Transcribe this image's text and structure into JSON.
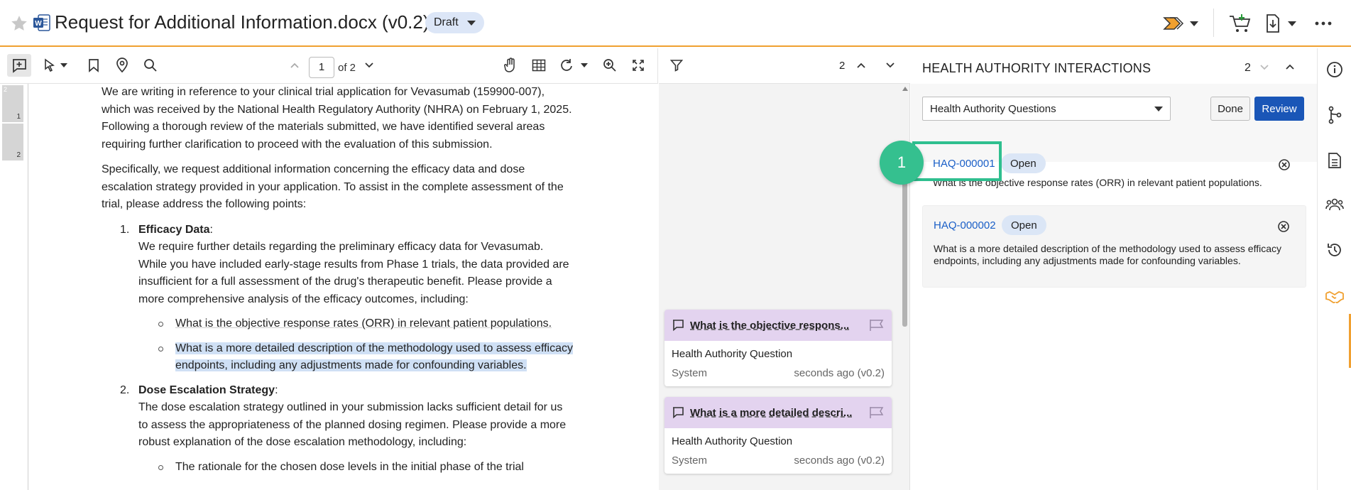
{
  "header": {
    "title": "Request for Additional Information.docx (v0.2)",
    "status": "Draft"
  },
  "doc_toolbar": {
    "page_current": "1",
    "page_of": "of 2"
  },
  "thumbnails": [
    {
      "top_label": "2",
      "label": "1"
    },
    {
      "top_label": "",
      "label": "2"
    }
  ],
  "document": {
    "p1": "We are writing in reference to your clinical trial application for Vevasumab (159900-007), which was received by the National Health Regulatory Authority (NHRA) on February 1, 2025. Following a thorough review of the materials submitted, we have identified several areas requiring further clarification to proceed with the evaluation of this submission.",
    "p2": "Specifically, we request additional information concerning the efficacy data and dose escalation strategy provided in your application. To assist in the complete assessment of the trial, please address the following points:",
    "item1_num": "1.",
    "item1_title": "Efficacy Data",
    "item1_body": "We require further details regarding the preliminary efficacy data for Vevasumab. While you have included early-stage results from Phase 1 trials, the data provided are insufficient for a full assessment of the drug's therapeutic benefit. Please provide a more comprehensive analysis of the efficacy outcomes, including:",
    "sub1": "What is the objective response rates (ORR) in relevant patient populations.",
    "sub2": "What is a more detailed description of the methodology used to assess efficacy endpoints, including any adjustments made for confounding variables.",
    "item2_num": "2.",
    "item2_title": "Dose Escalation Strategy",
    "item2_body": "The dose escalation strategy outlined in your submission lacks sufficient detail for us to assess the appropriateness of the planned dosing regimen. Please provide a more robust explanation of the dose escalation methodology, including:",
    "sub3": "The rationale for the chosen dose levels in the initial phase of the trial"
  },
  "comments_toolbar": {
    "count": "2"
  },
  "comment_cards": [
    {
      "title": "What is the objective respons...",
      "type": "Health Authority Question",
      "author": "System",
      "time": "seconds ago (v0.2)"
    },
    {
      "title": "What is a more detailed descri...",
      "type": "Health Authority Question",
      "author": "System",
      "time": "seconds ago (v0.2)"
    }
  ],
  "ha_panel": {
    "title": "HEALTH AUTHORITY INTERACTIONS",
    "count": "2",
    "select_value": "Health Authority Questions",
    "done_label": "Done",
    "review_label": "Review",
    "items": [
      {
        "id": "HAQ-000001",
        "status": "Open",
        "text": "What is the objective response rates (ORR) in relevant patient populations."
      },
      {
        "id": "HAQ-000002",
        "status": "Open",
        "text": "What is a more detailed description of the methodology used to assess efficacy endpoints, including any adjustments made for confounding variables."
      }
    ],
    "step_badge": "1"
  },
  "colors": {
    "accent_orange": "#f0a030",
    "primary_blue": "#1a56b7",
    "highlight_green": "#35c08f",
    "comment_purple": "#e3d3ef"
  }
}
